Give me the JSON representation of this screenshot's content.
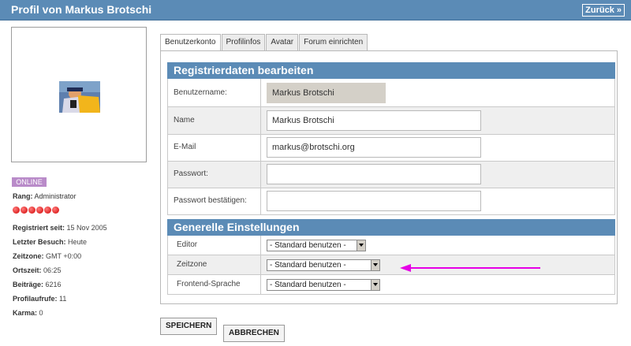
{
  "header": {
    "title": "Profil von Markus Brotschi",
    "back_label": "Zurück »"
  },
  "profile": {
    "status": "ONLINE",
    "rank_label": "Rang:",
    "rank_value": "Administrator",
    "rank_dots": 6,
    "stats": [
      {
        "label": "Registriert seit:",
        "value": "15 Nov 2005"
      },
      {
        "label": "Letzter Besuch:",
        "value": "Heute"
      },
      {
        "label": "Zeitzone:",
        "value": "GMT +0:00"
      },
      {
        "label": "Ortszeit:",
        "value": "06:25"
      },
      {
        "label": "Beiträge:",
        "value": "6216"
      },
      {
        "label": "Profilaufrufe:",
        "value": "11"
      },
      {
        "label": "Karma:",
        "value": "0"
      }
    ]
  },
  "tabs": [
    "Benutzerkonto",
    "Profilinfos",
    "Avatar",
    "Forum einrichten"
  ],
  "registration": {
    "header": "Registrierdaten bearbeiten",
    "username_label": "Benutzername:",
    "username_value": "Markus Brotschi",
    "name_label": "Name",
    "name_value": "Markus Brotschi",
    "email_label": "E-Mail",
    "email_value": "markus@brotschi.org",
    "password_label": "Passwort:",
    "password_value": "",
    "password_confirm_label": "Passwort bestätigen:",
    "password_confirm_value": ""
  },
  "general": {
    "header": "Generelle Einstellungen",
    "editor_label": "Editor",
    "editor_value": "- Standard benutzen -",
    "timezone_label": "Zeitzone",
    "timezone_value": "- Standard benutzen -",
    "language_label": "Frontend-Sprache",
    "language_value": "- Standard benutzen -"
  },
  "actions": {
    "save_label": "SPEICHERN",
    "cancel_label": "ABBRECHEN"
  },
  "colors": {
    "header_blue": "#5b8bb6",
    "annotation_arrow": "#e600e6",
    "online_badge": "#b98bc9",
    "rank_dot": "#d10000"
  }
}
